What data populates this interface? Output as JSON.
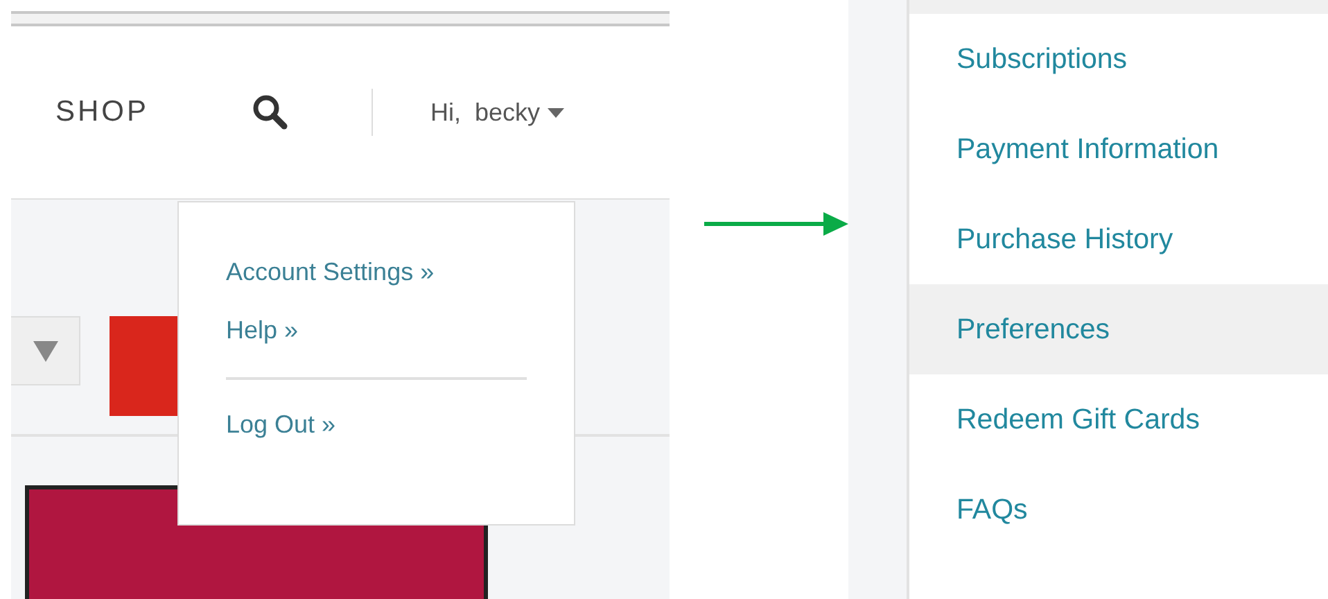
{
  "header": {
    "nav_label": "SHOP",
    "greeting": "Hi,  becky"
  },
  "user_menu": {
    "groups": [
      {
        "items": [
          {
            "label": "Account Settings »"
          },
          {
            "label": "Help »"
          }
        ]
      },
      {
        "items": [
          {
            "label": "Log Out »"
          }
        ]
      }
    ]
  },
  "account_menu": {
    "items": [
      {
        "label": "Subscriptions",
        "selected": false
      },
      {
        "label": "Payment Information",
        "selected": false
      },
      {
        "label": "Purchase History",
        "selected": false
      },
      {
        "label": "Preferences",
        "selected": true
      },
      {
        "label": "Redeem Gift Cards",
        "selected": false
      },
      {
        "label": "FAQs",
        "selected": false
      }
    ]
  }
}
